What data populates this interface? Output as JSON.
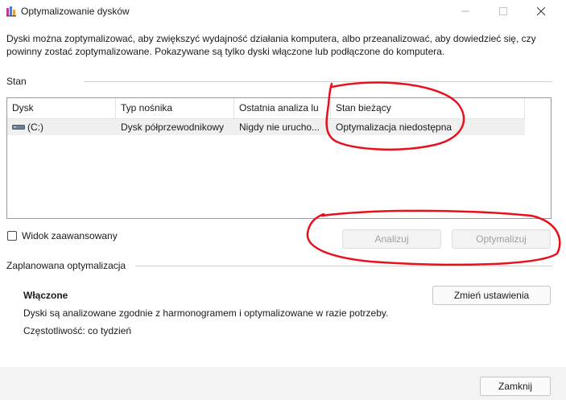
{
  "window": {
    "title": "Optymalizowanie dysków",
    "controls": {
      "minimize": "—",
      "maximize": "☐",
      "close": "✕"
    }
  },
  "description": "Dyski można zoptymalizować, aby zwiększyć wydajność działania komputera, albo przeanalizować, aby dowiedzieć się, czy powinny zostać zoptymalizowane. Pokazywane są tylko dyski włączone lub podłączone do komputera.",
  "status_section": {
    "label": "Stan",
    "columns": [
      "Dysk",
      "Typ nośnika",
      "Ostatnia analiza lu",
      "Stan bieżący"
    ],
    "drives": [
      {
        "name": "(C:)",
        "icon": "drive-icon",
        "media_type": "Dysk półprzewodnikowy",
        "last_run": "Nigdy nie urucho...",
        "current_status": "Optymalizacja niedostępna"
      }
    ]
  },
  "advanced_view_label": "Widok zaawansowany",
  "buttons": {
    "analyze": "Analizuj",
    "optimize": "Optymalizuj",
    "change_settings": "Zmień ustawienia",
    "close": "Zamknij"
  },
  "scheduled_section": {
    "label": "Zaplanowana optymalizacja",
    "status": "Włączone",
    "description": "Dyski są analizowane zgodnie z harmonogramem i optymalizowane w razie potrzeby.",
    "frequency": "Częstotliwość: co tydzień"
  },
  "colors": {
    "annotation": "#e8101c",
    "selected_row": "#f0f0f0",
    "footer": "#f3f3f3",
    "disabled_text": "#a0a0a0"
  }
}
